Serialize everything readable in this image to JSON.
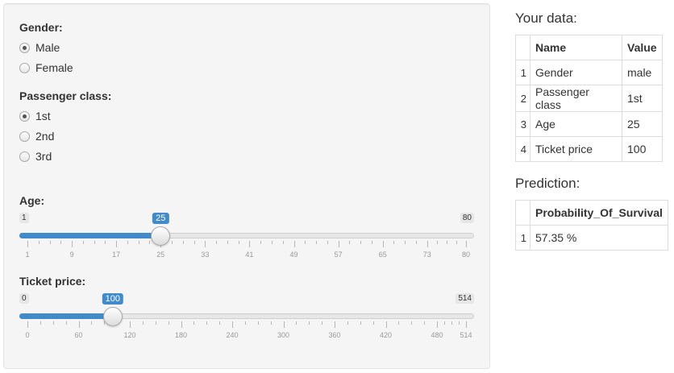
{
  "inputs": {
    "gender": {
      "label": "Gender:",
      "options": [
        "Male",
        "Female"
      ],
      "selected": "Male"
    },
    "passenger_class": {
      "label": "Passenger class:",
      "options": [
        "1st",
        "2nd",
        "3rd"
      ],
      "selected": "1st"
    },
    "age": {
      "label": "Age:",
      "min": 1,
      "max": 80,
      "value": 25,
      "min_label": "1",
      "max_label": "80",
      "value_label": "25",
      "tick_labels": [
        "1",
        "9",
        "17",
        "25",
        "33",
        "41",
        "49",
        "57",
        "65",
        "73",
        "80"
      ]
    },
    "ticket_price": {
      "label": "Ticket price:",
      "min": 0,
      "max": 514,
      "value": 100,
      "min_label": "0",
      "max_label": "514",
      "value_label": "100",
      "tick_labels": [
        "0",
        "60",
        "120",
        "180",
        "240",
        "300",
        "360",
        "420",
        "480",
        "514"
      ]
    }
  },
  "your_data": {
    "title": "Your data:",
    "headers": [
      "Name",
      "Value"
    ],
    "rows": [
      {
        "idx": "1",
        "name": "Gender",
        "value": "male"
      },
      {
        "idx": "2",
        "name": "Passenger class",
        "value": "1st"
      },
      {
        "idx": "3",
        "name": "Age",
        "value": "25"
      },
      {
        "idx": "4",
        "name": "Ticket price",
        "value": "100"
      }
    ]
  },
  "prediction": {
    "title": "Prediction:",
    "header": "Probability_Of_Survival",
    "rows": [
      {
        "idx": "1",
        "value": "57.35 %"
      }
    ]
  },
  "colors": {
    "accent": "#428bca",
    "well_bg": "#f5f5f5"
  }
}
